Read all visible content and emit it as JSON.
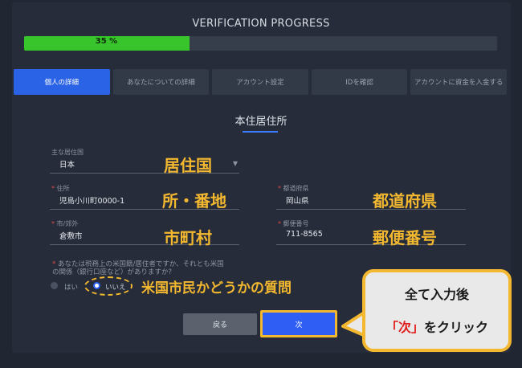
{
  "header": {
    "title": "VERIFICATION PROGRESS"
  },
  "progress": {
    "percent": 35,
    "label": "35 %"
  },
  "tabs": [
    {
      "label": "個人の詳細",
      "active": true
    },
    {
      "label": "あなたについての詳細",
      "active": false
    },
    {
      "label": "アカウント設定",
      "active": false
    },
    {
      "label": "IDを確認",
      "active": false
    },
    {
      "label": "アカウントに資金を入金する",
      "active": false
    }
  ],
  "section": {
    "title": "本住居住所"
  },
  "fields": {
    "country": {
      "label": "主な居住国",
      "value": "日本"
    },
    "address": {
      "label": "住所",
      "value": "児島小川町0000-1"
    },
    "prefecture": {
      "label": "都道府県",
      "value": "岡山県"
    },
    "city": {
      "label": "市/郊外",
      "value": "倉敷市"
    },
    "postal": {
      "label": "郵便番号",
      "value": "711-8565"
    }
  },
  "question": {
    "line1": "あなたは税務上の米国籍/居住者ですか、それとも米国",
    "line2": "の関係（銀行口座など）がありますか?",
    "options": [
      {
        "label": "はい",
        "selected": false
      },
      {
        "label": "いいえ",
        "selected": true
      }
    ]
  },
  "buttons": {
    "back": "戻る",
    "next": "次"
  },
  "annotations": {
    "country": "居住国",
    "address": "所・番地",
    "prefecture": "都道府県",
    "city": "市町村",
    "postal": "郵便番号",
    "question": "米国市民かどうかの質問"
  },
  "callout": {
    "line1": "全て入力後",
    "quoted": "「次」",
    "line2_rest": "をクリック"
  },
  "colors": {
    "accent": "#2b63e6",
    "progress": "#37c52b",
    "highlight": "#f3b82f",
    "required": "#e14a4a"
  }
}
